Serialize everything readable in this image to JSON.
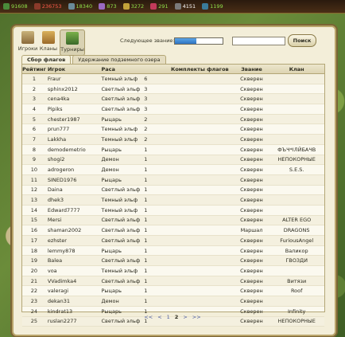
{
  "top_bar": {
    "resources": [
      {
        "icon": "stone-icon",
        "value": "91608",
        "color": "#4a8a3a",
        "tone": "green"
      },
      {
        "icon": "ore-icon",
        "value": "236753",
        "color": "#8a3a2a",
        "tone": "red"
      },
      {
        "icon": "weapons-icon",
        "value": "18340",
        "color": "#6a8a9a",
        "tone": "green"
      },
      {
        "icon": "crystal-icon",
        "value": "873",
        "color": "#9a6ac2",
        "tone": "green"
      },
      {
        "icon": "gold-icon",
        "value": "3272",
        "color": "#c2a23a",
        "tone": "green"
      },
      {
        "icon": "gem-icon",
        "value": "291",
        "color": "#c23a5a",
        "tone": "green"
      },
      {
        "icon": "castle-icon",
        "value": "4151",
        "color": "#7a7a7a",
        "tone": "white"
      },
      {
        "icon": "population-icon",
        "value": "1199",
        "color": "#3a7a9a",
        "tone": "green"
      }
    ]
  },
  "toolbar": {
    "players_label": "Игроки",
    "clans_label": "Кланы",
    "tournaments_label": "Турниры",
    "next_title_label": "Следующее звание:",
    "next_title_progress": 0.45,
    "search_value": "",
    "search_label": "Поиск"
  },
  "tabs": [
    {
      "label": "Сбор флагов",
      "active": true
    },
    {
      "label": "Удержание подземного озера",
      "active": false
    }
  ],
  "table": {
    "headers": {
      "rank": "Рейтинг",
      "player": "Игрок",
      "race": "Раса",
      "flags": "",
      "kits": "Комплекты флагов",
      "title": "Звание",
      "clan": "Клан"
    },
    "rows": [
      {
        "rank": "1",
        "player": "Fraur",
        "race": "Темный эльф",
        "flags": "6",
        "title": "Скверен",
        "clan": ""
      },
      {
        "rank": "2",
        "player": "sphinx2012",
        "race": "Светлый эльф",
        "flags": "3",
        "title": "Скверен",
        "clan": ""
      },
      {
        "rank": "3",
        "player": "cena4ka",
        "race": "Светлый эльф",
        "flags": "3",
        "title": "Скверен",
        "clan": ""
      },
      {
        "rank": "4",
        "player": "Pipiks",
        "race": "Светлый эльф",
        "flags": "3",
        "title": "Скверен",
        "clan": ""
      },
      {
        "rank": "5",
        "player": "chester1987",
        "race": "Рыцарь",
        "flags": "2",
        "title": "Скверен",
        "clan": ""
      },
      {
        "rank": "6",
        "player": "prun777",
        "race": "Темный эльф",
        "flags": "2",
        "title": "Скверен",
        "clan": ""
      },
      {
        "rank": "7",
        "player": "Lakkha",
        "race": "Темный эльф",
        "flags": "2",
        "title": "Скверен",
        "clan": ""
      },
      {
        "rank": "8",
        "player": "demodemetrio",
        "race": "Рыцарь",
        "flags": "1",
        "title": "Скверен",
        "clan": "ФЪЧ*ІЛЙБАЧВ"
      },
      {
        "rank": "9",
        "player": "shogi2",
        "race": "Демон",
        "flags": "1",
        "title": "Скверен",
        "clan": "НЕПОКОРНЫЕ"
      },
      {
        "rank": "10",
        "player": "adrogeron",
        "race": "Демон",
        "flags": "1",
        "title": "Скверен",
        "clan": "S.E.S."
      },
      {
        "rank": "11",
        "player": "SINED1976",
        "race": "Рыцарь",
        "flags": "1",
        "title": "Скверен",
        "clan": ""
      },
      {
        "rank": "12",
        "player": "Daina",
        "race": "Светлый эльф",
        "flags": "1",
        "title": "Скверен",
        "clan": ""
      },
      {
        "rank": "13",
        "player": "dhek3",
        "race": "Темный эльф",
        "flags": "1",
        "title": "Скверен",
        "clan": ""
      },
      {
        "rank": "14",
        "player": "Edward7777",
        "race": "Темный эльф",
        "flags": "1",
        "title": "Скверен",
        "clan": ""
      },
      {
        "rank": "15",
        "player": "Mersi",
        "race": "Светлый эльф",
        "flags": "1",
        "title": "Скверен",
        "clan": "ALTER EGO"
      },
      {
        "rank": "16",
        "player": "shaman2002",
        "race": "Светлый эльф",
        "flags": "1",
        "title": "Маршал",
        "clan": "DRAGONS"
      },
      {
        "rank": "17",
        "player": "ezhster",
        "race": "Светлый эльф",
        "flags": "1",
        "title": "Скверен",
        "clan": "FuriousAngel"
      },
      {
        "rank": "18",
        "player": "lemmy878",
        "race": "Рыцарь",
        "flags": "1",
        "title": "Скверен",
        "clan": "Валикор"
      },
      {
        "rank": "19",
        "player": "Balea",
        "race": "Светлый эльф",
        "flags": "1",
        "title": "Скверен",
        "clan": "ГВОЗДИ"
      },
      {
        "rank": "20",
        "player": "voa",
        "race": "Темный эльф",
        "flags": "1",
        "title": "Скверен",
        "clan": ""
      },
      {
        "rank": "21",
        "player": "VVadimka4",
        "race": "Светлый эльф",
        "flags": "1",
        "title": "Скверен",
        "clan": "Витязи"
      },
      {
        "rank": "22",
        "player": "valeragi",
        "race": "Рыцарь",
        "flags": "1",
        "title": "Скверен",
        "clan": "Roof"
      },
      {
        "rank": "23",
        "player": "dekan31",
        "race": "Демон",
        "flags": "1",
        "title": "Скверен",
        "clan": ""
      },
      {
        "rank": "24",
        "player": "kindrat13",
        "race": "Рыцарь",
        "flags": "1",
        "title": "Скверен",
        "clan": "Infinity"
      },
      {
        "rank": "25",
        "player": "ruslan2277",
        "race": "Светлый эльф",
        "flags": "1",
        "title": "Скверен",
        "clan": "НЕПОКОРНЫЕ"
      }
    ]
  },
  "pager": {
    "first": "<<",
    "prev": "<",
    "page1": "1",
    "page2": "2",
    "next": ">",
    "last": ">>"
  }
}
